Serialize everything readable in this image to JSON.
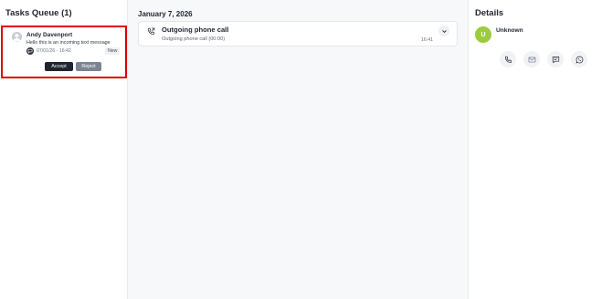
{
  "queue": {
    "title": "Tasks Queue (1)",
    "task": {
      "name": "Andy Davenport",
      "message": "Hello this is an incoming text message",
      "channel_icon": "chat-bubble-icon",
      "datetime": "07/01/26 - 16:42",
      "badge": "New",
      "accept_label": "Accept",
      "reject_label": "Reject"
    }
  },
  "timeline": {
    "date": "January 7, 2026",
    "entries": [
      {
        "icon": "phone-outgoing-icon",
        "title": "Outgoing phone call",
        "subtitle": "Outgoing phone call",
        "duration": "(00:00)",
        "time": "16:41"
      }
    ]
  },
  "details": {
    "title": "Details",
    "contact": {
      "initial": "U",
      "name": "Unknown",
      "avatar_color": "#9bcd3a"
    },
    "actions": [
      "phone-icon",
      "email-icon",
      "message-icon",
      "whatsapp-icon"
    ]
  },
  "colors": {
    "highlight_border": "#e00000",
    "primary_button": "#1f2430",
    "secondary_button": "#7b8494"
  }
}
